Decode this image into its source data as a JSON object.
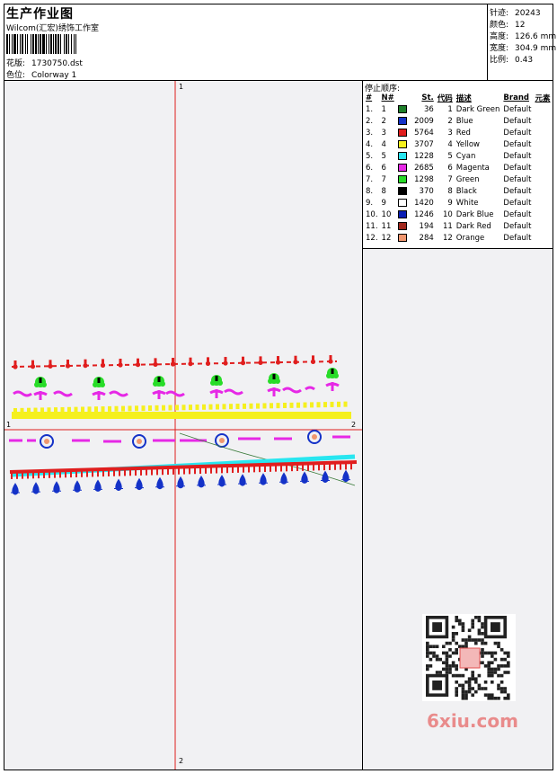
{
  "header": {
    "title": "生产作业图",
    "company": "Wilcom(汇宏)绣饰工作室",
    "design_label": "花版:",
    "design_value": "1730750.dst",
    "colorway_label": "色位:",
    "colorway_value": "Colorway 1"
  },
  "stats": [
    {
      "label": "针迹:",
      "value": "20243"
    },
    {
      "label": "颜色:",
      "value": "12"
    },
    {
      "label": "高度:",
      "value": "126.6 mm"
    },
    {
      "label": "宽度:",
      "value": "304.9 mm"
    },
    {
      "label": "比例:",
      "value": "0.43"
    }
  ],
  "stop_sequence": {
    "title": "停止顺序:",
    "headers": [
      "#",
      "N#",
      "St.",
      "代码",
      "描述",
      "Brand",
      "元素"
    ],
    "rows": [
      {
        "idx": "1.",
        "n": "1",
        "color": "#1e7f2a",
        "st": "36",
        "code": "1",
        "desc": "Dark Green",
        "brand": "Default"
      },
      {
        "idx": "2.",
        "n": "2",
        "color": "#1432c8",
        "st": "2009",
        "code": "2",
        "desc": "Blue",
        "brand": "Default"
      },
      {
        "idx": "3.",
        "n": "3",
        "color": "#e01e1e",
        "st": "5764",
        "code": "3",
        "desc": "Red",
        "brand": "Default"
      },
      {
        "idx": "4.",
        "n": "4",
        "color": "#f5f01e",
        "st": "3707",
        "code": "4",
        "desc": "Yellow",
        "brand": "Default"
      },
      {
        "idx": "5.",
        "n": "5",
        "color": "#28e6f0",
        "st": "1228",
        "code": "5",
        "desc": "Cyan",
        "brand": "Default"
      },
      {
        "idx": "6.",
        "n": "6",
        "color": "#e628e6",
        "st": "2685",
        "code": "6",
        "desc": "Magenta",
        "brand": "Default"
      },
      {
        "idx": "7.",
        "n": "7",
        "color": "#28dc28",
        "st": "1298",
        "code": "7",
        "desc": "Green",
        "brand": "Default"
      },
      {
        "idx": "8.",
        "n": "8",
        "color": "#000000",
        "st": "370",
        "code": "8",
        "desc": "Black",
        "brand": "Default"
      },
      {
        "idx": "9.",
        "n": "9",
        "color": "#ffffff",
        "st": "1420",
        "code": "9",
        "desc": "White",
        "brand": "Default"
      },
      {
        "idx": "10.",
        "n": "10",
        "color": "#0a1eb4",
        "st": "1246",
        "code": "10",
        "desc": "Dark Blue",
        "brand": "Default"
      },
      {
        "idx": "11.",
        "n": "11",
        "color": "#a0281e",
        "st": "194",
        "code": "11",
        "desc": "Dark Red",
        "brand": "Default"
      },
      {
        "idx": "12.",
        "n": "12",
        "color": "#f0966e",
        "st": "284",
        "code": "12",
        "desc": "Orange",
        "brand": "Default"
      }
    ]
  },
  "axis_labels": {
    "top": "1",
    "bottom": "2",
    "left": "1",
    "right": "2"
  },
  "watermark": "6xiu.com",
  "colors": {
    "crosshair": "#e01e1e"
  }
}
